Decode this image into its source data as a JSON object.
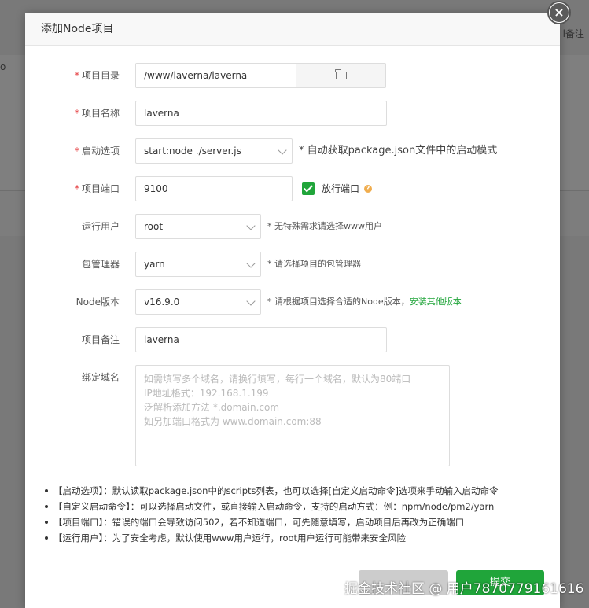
{
  "background": {
    "remark_label": "l备注",
    "row_text": "o"
  },
  "dialog": {
    "title": "添加Node项目",
    "close_label": "×"
  },
  "form": {
    "project_dir": {
      "label": "项目目录",
      "value": "/www/laverna/laverna",
      "icon": "folder-icon"
    },
    "project_name": {
      "label": "项目名称",
      "value": "laverna"
    },
    "start_option": {
      "label": "启动选项",
      "value": "start:node ./server.js",
      "hint": "* 自动获取package.json文件中的启动模式"
    },
    "project_port": {
      "label": "项目端口",
      "value": "9100",
      "checkbox_label": "放行端口",
      "checked": true
    },
    "run_user": {
      "label": "运行用户",
      "value": "root",
      "hint": "* 无特殊需求请选择www用户"
    },
    "package_manager": {
      "label": "包管理器",
      "value": "yarn",
      "hint": "* 请选择项目的包管理器"
    },
    "node_version": {
      "label": "Node版本",
      "value": "v16.9.0",
      "hint": "* 请根据项目选择合适的Node版本，",
      "link": "安装其他版本"
    },
    "project_remark": {
      "label": "项目备注",
      "value": "laverna"
    },
    "bind_domain": {
      "label": "绑定域名",
      "placeholder_lines": [
        "如需填写多个域名，请换行填写，每行一个域名，默认为80端口",
        "IP地址格式：192.168.1.199",
        "泛解析添加方法 *.domain.com",
        "如另加端口格式为 www.domain.com:88"
      ]
    }
  },
  "notes": [
    "【启动选项】：默认读取package.json中的scripts列表，也可以选择[自定义启动命令]选项来手动输入启动命令",
    "【自定义启动命令】：可以选择启动文件，或直接输入启动命令，支持的启动方式：例：npm/node/pm2/yarn",
    "【项目端口】：错误的端口会导致访问502，若不知道端口，可先随意填写，启动项目后再改为正确端口",
    "【运行用户】：为了安全考虑，默认使用www用户运行，root用户运行可能带来安全风险"
  ],
  "footer": {
    "cancel_label": "",
    "submit_label": "提交"
  },
  "watermark": "掘金技术社区 @ 用户7870779161616",
  "colors": {
    "accent": "#20a53a",
    "required": "#e4393c",
    "help": "#f0ad4e"
  }
}
